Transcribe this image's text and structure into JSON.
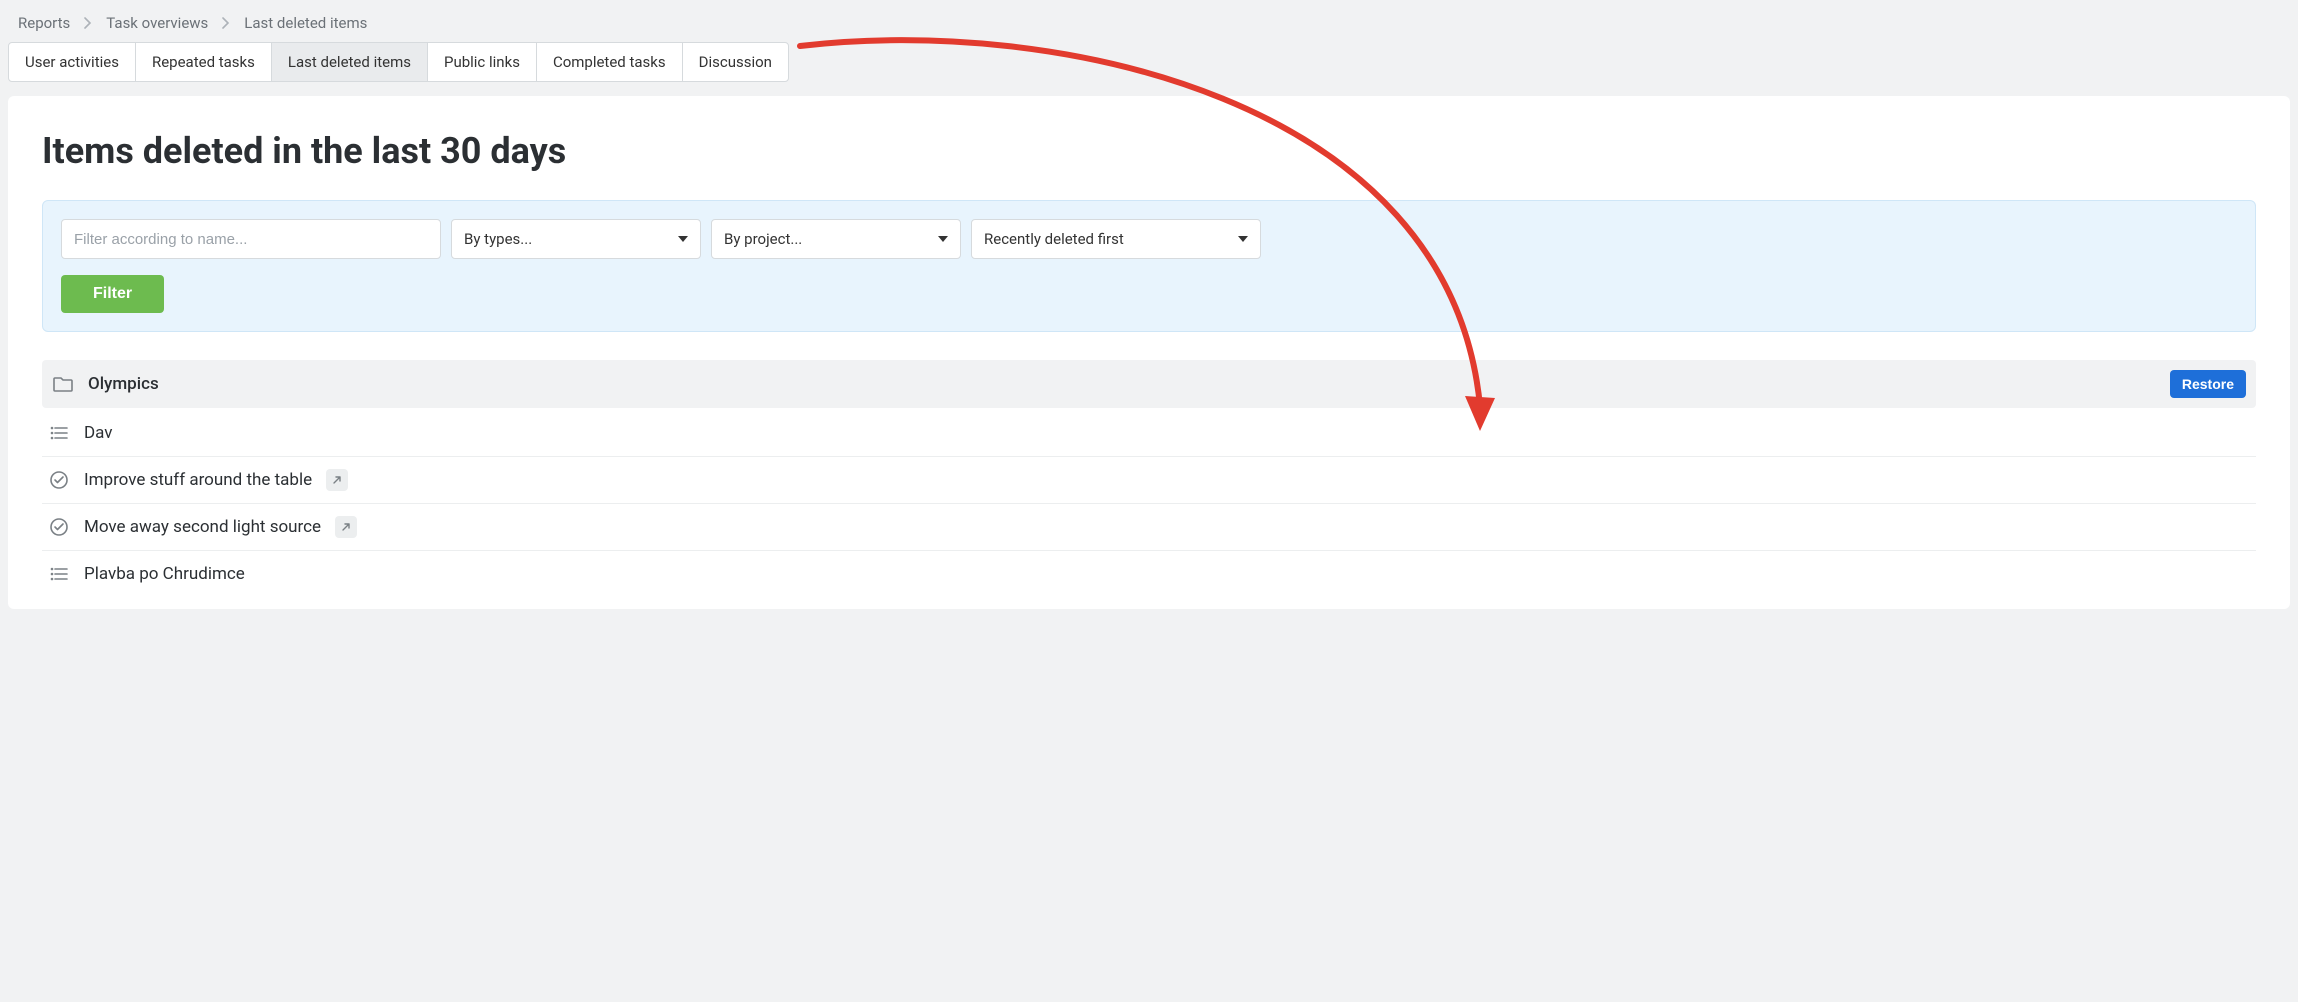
{
  "breadcrumb": {
    "level1": "Reports",
    "level2": "Task overviews",
    "level3": "Last deleted items"
  },
  "tabs": {
    "t0": "User activities",
    "t1": "Repeated tasks",
    "t2": "Last deleted items",
    "t3": "Public links",
    "t4": "Completed tasks",
    "t5": "Discussion"
  },
  "title": "Items deleted in the last 30 days",
  "filters": {
    "name_placeholder": "Filter according to name...",
    "types_label": "By types...",
    "project_label": "By project...",
    "sort_label": "Recently deleted first",
    "filter_button": "Filter"
  },
  "items": [
    {
      "kind": "folder",
      "name": "Olympics",
      "restorable": true
    },
    {
      "kind": "list",
      "name": "Dav"
    },
    {
      "kind": "task",
      "name": "Improve stuff around the table",
      "has_link": true
    },
    {
      "kind": "task",
      "name": "Move away second light source",
      "has_link": true
    },
    {
      "kind": "list",
      "name": "Plavba po Chrudimce"
    }
  ],
  "buttons": {
    "restore": "Restore"
  },
  "colors": {
    "accent_blue": "#1e6fd9",
    "accent_green": "#6dbb4f",
    "panel_blue": "#e8f4fd"
  }
}
